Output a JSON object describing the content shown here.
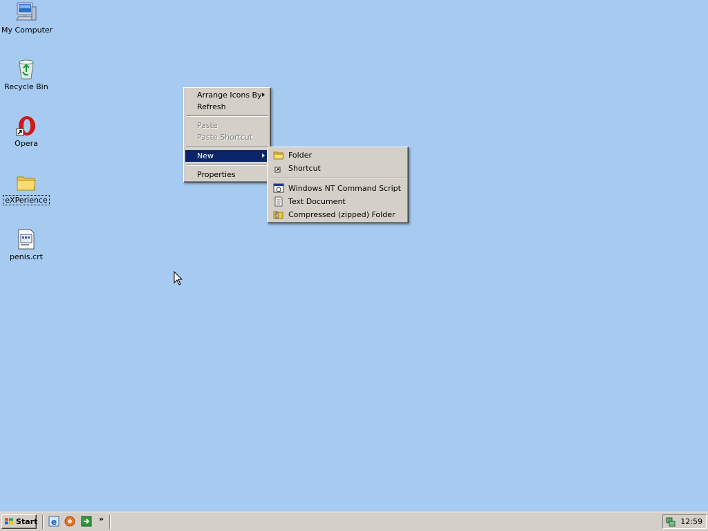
{
  "desktop": {
    "icons": [
      {
        "label": "My Computer",
        "icon": "my-computer-icon"
      },
      {
        "label": "Recycle Bin",
        "icon": "recycle-bin-icon"
      },
      {
        "label": "Opera",
        "icon": "opera-icon"
      },
      {
        "label": "eXPerience",
        "icon": "folder-icon"
      },
      {
        "label": "penis.crt",
        "icon": "certificate-file-icon"
      }
    ]
  },
  "context_menu": {
    "items": [
      {
        "label": "Arrange Icons By",
        "has_submenu": true
      },
      {
        "label": "Refresh"
      },
      {
        "label": "Paste",
        "disabled": true
      },
      {
        "label": "Paste Shortcut",
        "disabled": true
      },
      {
        "label": "New",
        "has_submenu": true,
        "selected": true
      },
      {
        "label": "Properties"
      }
    ]
  },
  "new_submenu": {
    "items": [
      {
        "label": "Folder",
        "icon": "folder-icon"
      },
      {
        "label": "Shortcut",
        "icon": "shortcut-icon"
      },
      {
        "label": "Windows NT Command Script",
        "icon": "command-script-icon"
      },
      {
        "label": "Text Document",
        "icon": "text-document-icon"
      },
      {
        "label": "Compressed (zipped) Folder",
        "icon": "zipped-folder-icon"
      }
    ]
  },
  "taskbar": {
    "start_label": "Start",
    "quick_launch": [
      "internet-explorer-icon",
      "media-player-icon",
      "show-desktop-icon"
    ],
    "chevron": "»",
    "clock": "12:59"
  },
  "colors": {
    "desktop_background": "#a6caf0",
    "menu_background": "#d4d0c8",
    "selection": "#0a246a"
  }
}
